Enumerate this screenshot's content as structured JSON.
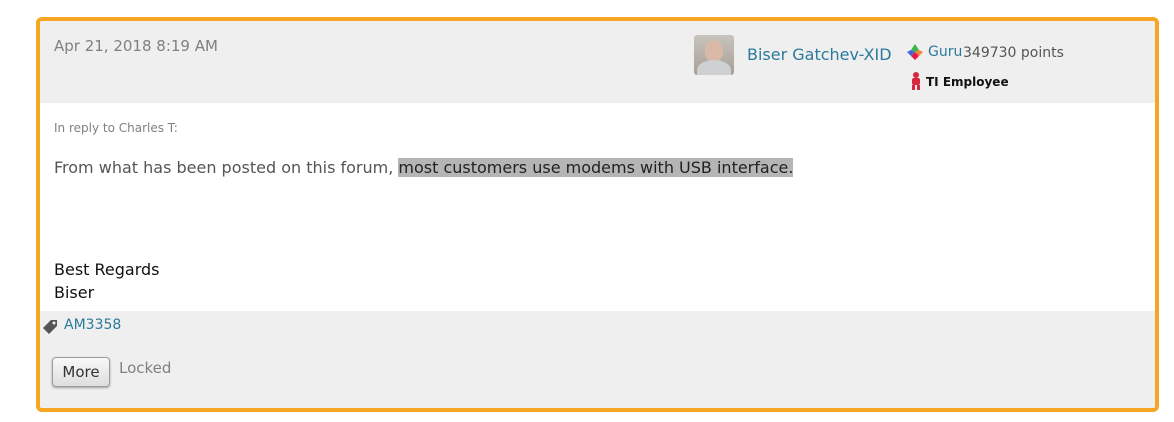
{
  "post": {
    "date": "Apr 21, 2018 8:19 AM",
    "author": {
      "name": "Biser Gatchev-XID",
      "rank": "Guru",
      "points": "349730 points",
      "employee_badge": "TI Employee"
    },
    "reply_to": "In reply to Charles T:",
    "body": {
      "lead": "From what has been posted on this forum, ",
      "highlighted": "most customers use modems with USB interface.",
      "closing_line_1": "Best Regards",
      "closing_line_2": "Biser"
    },
    "tag": "AM3358",
    "actions": {
      "more_label": "More",
      "locked_label": "Locked"
    }
  },
  "colors": {
    "frame_border": "#f5a623",
    "header_bg": "#efefef",
    "link": "#2b7a9b",
    "highlight_bg": "#b5b5b5"
  },
  "icons": {
    "rank": "guru-rank-icon",
    "employee": "ti-employee-icon",
    "tag": "tag-icon"
  }
}
